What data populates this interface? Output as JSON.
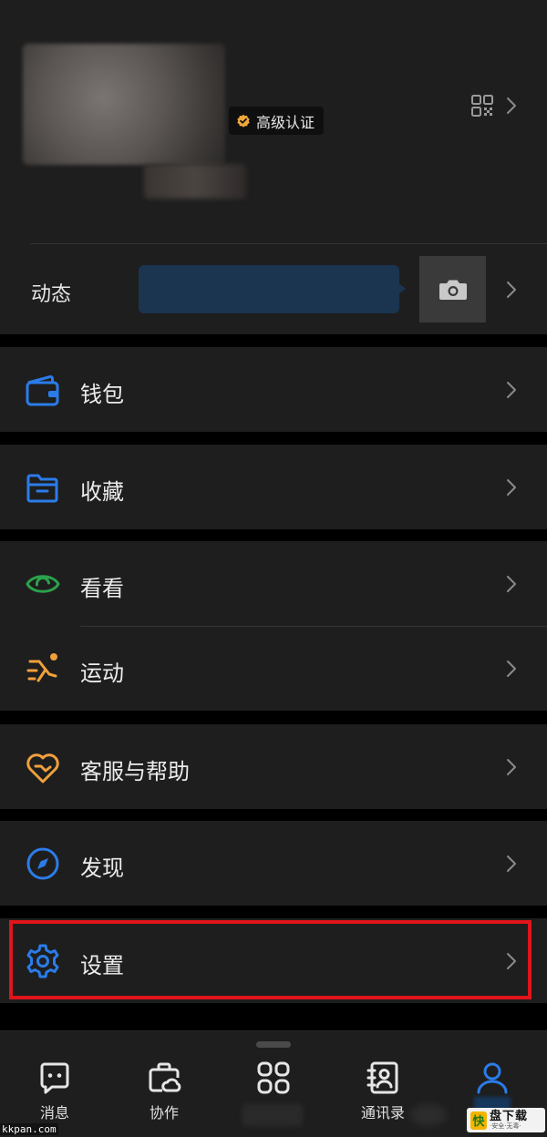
{
  "profile": {
    "badge_label": "高级认证",
    "moments_label": "动态"
  },
  "menu": {
    "wallet": "钱包",
    "favorites": "收藏",
    "watch": "看看",
    "sport": "运动",
    "help": "客服与帮助",
    "discover": "发现",
    "settings": "设置"
  },
  "bottom_nav": {
    "messages": "消息",
    "collab": "协作",
    "contacts": "通讯录"
  },
  "watermark": {
    "url": "kkpan.com",
    "logo_mark": "快",
    "logo_text": "盘下载",
    "logo_sub": "·安全·无毒·"
  },
  "colors": {
    "background": "#000000",
    "card": "#1e1e1e",
    "accent_blue": "#2b7ce9",
    "green": "#2ba24c",
    "orange": "#f0a03c",
    "highlight_red": "#e0141a",
    "badge_orange": "#f0a83c"
  }
}
